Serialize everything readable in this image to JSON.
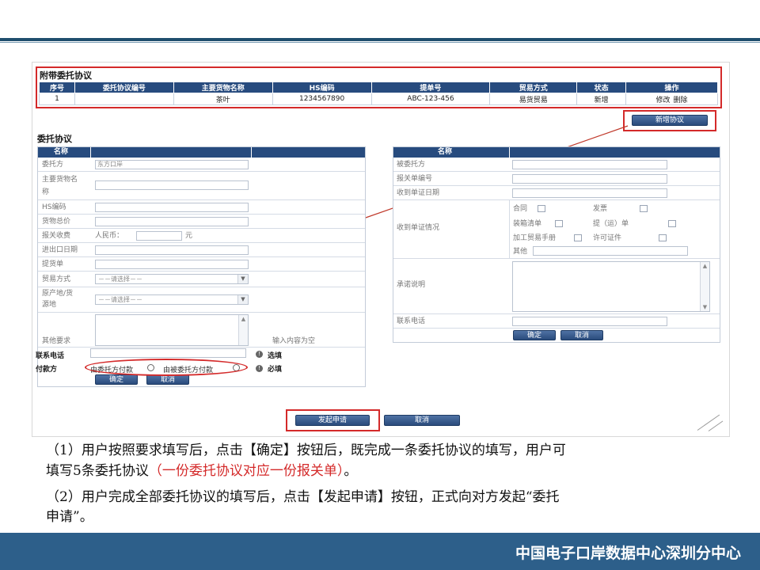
{
  "attached_section": {
    "title": "附带委托协议",
    "columns": [
      "序号",
      "委托协议编号",
      "主要货物名称",
      "HS编码",
      "提单号",
      "贸易方式",
      "状态",
      "操作"
    ],
    "row": {
      "index": "1",
      "agreement_no": "",
      "goods_name": "茶叶",
      "hs_code": "1234567890",
      "bill_no": "ABC-123-456",
      "trade_mode": "易货贸易",
      "status": "新增",
      "edit": "修改",
      "delete": "删除"
    },
    "add_button": "新增协议"
  },
  "agreement_form": {
    "title": "委托协议",
    "left": {
      "header": "名称",
      "principal_label": "委托方",
      "principal_value": "东方口岸",
      "goods_name_label_1": "主要货物名",
      "goods_name_label_2": "称",
      "hs_label": "HS编码",
      "total_value_label": "货物总价",
      "fee_label": "报关收费",
      "fee_prefix": "人民币：",
      "fee_unit": "元",
      "date_label": "进出口日期",
      "bill_label": "提货单",
      "trade_mode_label": "贸易方式",
      "trade_mode_value": "－－请选择－－",
      "origin_label_1": "原产地/货",
      "origin_label_2": "源地",
      "origin_value": "－－请选择－－",
      "other_label": "其他要求",
      "hint": "输入内容为空",
      "phone_label": "联系电话",
      "phone_tag": "选填",
      "payment_label": "付款方",
      "payment_option_1": "由委托方付款",
      "payment_option_2": "由被委托方付款",
      "payment_tag": "必填",
      "ok_button": "确定",
      "cancel_button": "取消"
    },
    "right": {
      "header": "名称",
      "agent_label": "被委托方",
      "declaration_no_label": "报关单编号",
      "receipt_date_label": "收到单证日期",
      "receipt_docs_label": "收到单证情况",
      "doc_contract": "合同",
      "doc_invoice": "发票",
      "doc_packing": "装箱清单",
      "doc_bill": "提（运）单",
      "doc_handbook": "加工贸易手册",
      "doc_license": "许可证件",
      "doc_other": "其他",
      "commitment_label": "承诺说明",
      "phone_label": "联系电话",
      "ok_button": "确定",
      "cancel_button": "取消"
    }
  },
  "bottom_buttons": {
    "submit": "发起申请",
    "cancel": "取消"
  },
  "caption": {
    "line1": "（1）用户按照要求填写后，点击【确定】按钮后，既完成一条委托协议的填写，用户可",
    "line2_a": "填写5条委托协议",
    "line2_red": "（一份委托协议对应一份报关单）",
    "line2_b": "。",
    "line3": "（2）用户完成全部委托协议的填写后，点击【发起申请】按钮，正式向对方发起“委托",
    "line4": "申请”。"
  },
  "footer": {
    "org": "中国电子口岸数据中心深圳分中心"
  },
  "colors": {
    "header_blue": "#274b7e",
    "highlight_red": "#d42a2a",
    "footer_blue": "#2d5f8a"
  }
}
